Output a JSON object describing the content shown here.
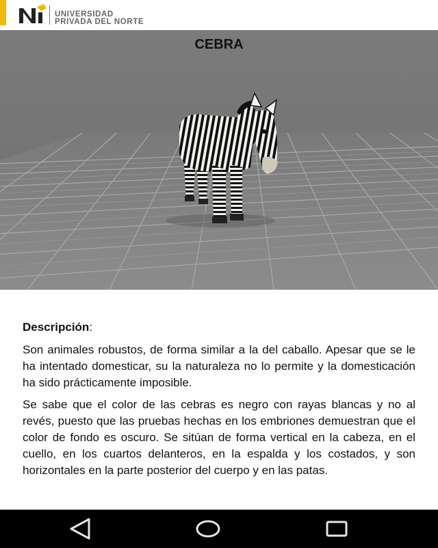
{
  "header": {
    "logo_line1": "UNIVERSIDAD",
    "logo_line2": "PRIVADA DEL NORTE",
    "accent_color": "#f2b800"
  },
  "viewport": {
    "title": "CEBRA",
    "model": "zebra-3d-model"
  },
  "description": {
    "heading": "Descripción",
    "heading_suffix": ":",
    "paragraphs": [
      "Son animales robustos, de forma similar a la del caballo. Apesar que se le ha intentado domesticar, su la naturaleza no lo permite y la domesticación ha sido prácticamente imposible.",
      "Se sabe que el color de las cebras es negro con rayas blancas y no al revés, puesto que las pruebas hechas en los embriones demuestran que el color de fondo es oscuro. Se sitúan de forma vertical en la cabeza, en el cuello, en los cuartos delanteros, en la espalda y los costados, y son horizontales en la parte posterior del cuerpo y en las patas."
    ]
  },
  "navbar": {
    "icons": [
      "back-icon",
      "home-icon",
      "recents-icon"
    ]
  }
}
